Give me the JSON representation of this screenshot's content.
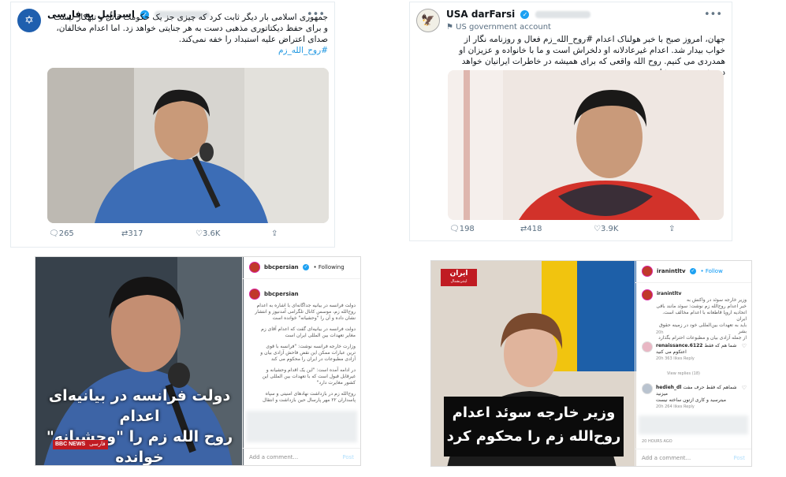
{
  "tweet1": {
    "name": "اسرائیل به فارسی",
    "body": "جمهوری اسلامی بار دیگر ثابت کرد که چیزی جز یک حکومت قاتل و تبهکار نیست و برای حفظ دیکتاتوری مذهبی دست به هر جنایتی خواهد زد. اما اعدام مخالفان، صدای اعتراض علیه استبداد را خفه نمی‌کند.",
    "hashtag": "#روح_الله_زم",
    "replies": "265",
    "retweets": "317",
    "likes": "3.6K"
  },
  "tweet2": {
    "name": "USA darFarsi",
    "subline": "US government account",
    "body": "جهان، امروز صبح با خبر هولناک اعدام #روح_الله_زم فعال و روزنامه نگار از خواب بیدار شد. اعدام غیرعادلانه او دلخراش است و ما با خانواده و عزیزان او همدردی می کنیم. روح الله واقعی که برای همیشه در خاطرات ایرانیان خواهد درخشید، روحت شاد زم.",
    "replies": "198",
    "retweets": "418",
    "likes": "3.9K"
  },
  "ig1": {
    "username": "bbcpersian",
    "follow": "• Following",
    "overlay_line1": "دولت فرانسه در بیانیه‌ای اعدام",
    "overlay_line2": "روح الله زم را \"وحشیانه\" خوانده",
    "bbc_label": "BBC NEWS",
    "bbc_lang": "فارسی",
    "caption_lines": [
      "دولت فرانسه در بیانیه جداگانه‌ای با اشاره به اعدام",
      "روح‌الله زم، موسس کانال تلگرامی آمدنیوز و انتشار",
      "نشان داده و آن را \"وحشیانه\" خوانده است",
      "دولت فرانسه در بیانیه‌ای گفت که اعدام آقای زم",
      "مغایر تعهدات بین المللی ایران است",
      "وزارت خارجه فرانسه نوشت: \"فرانسه با قوی",
      "ترین عبارات ممکن این نقض فاحش آزادی بیان و",
      "آزادی مطبوعات در ایران را محکوم می کند",
      "در ادامه آمده است: \"این یک اقدام وحشیانه و",
      "غیرقابل قبول است که با تعهدات بین المللی این",
      "کشور مغایرت دارد\"",
      "روح‌الله زم در بازداشت نهادهای امنیتی و سپاه",
      "پاسداران ۲۲ مهر پارسال حین بازداشت و انتقال"
    ],
    "add_comment": "Add a comment...",
    "post": "Post"
  },
  "ig2": {
    "username": "iranintltv",
    "follow": "• Follow",
    "channel_logo": "ایران",
    "channel_sub": "اینترنشنال",
    "overlay_line1": "وزیر خارجه سوئد اعدام",
    "overlay_line2": "روح‌الله زم را محکوم کرد",
    "caption_user": "iranintltv",
    "caption_lines": [
      "وزیر خارجه سوئد در واکنش به",
      "خبر اعدام روح‌الله زم نوشت: سوئد مانند باقی",
      "اتحادیه اروپا قاطعانه با اعدام مخالف است. ایران",
      "باید به تعهدات بین‌المللی خود در زمینه حقوق بشر",
      "از جمله آزادی بیان و مطبوعات احترام بگذارد"
    ],
    "caption_time": "20h",
    "comment1_user": "renaissance.6122",
    "comment1_text": "شما هم که فقط",
    "comment1_text2": "اعتکوم می کنید",
    "comment1_meta": "20h   363 likes   Reply",
    "view_replies": "View replies (18)",
    "comment2_user": "hedieh_dl",
    "comment2_text": "شماهم که فقط حرف مفت میزنید",
    "comment2_text2": "میترسید و کاری ازتون ساخته نیست",
    "comment2_meta": "20h   264 likes   Reply",
    "date": "20 HOURS AGO",
    "add_comment": "Add a comment...",
    "post": "Post"
  },
  "colors": {
    "twitter_blue": "#1da1f2",
    "instagram_link": "#0095f6",
    "overlay_red": "#c01b22"
  }
}
